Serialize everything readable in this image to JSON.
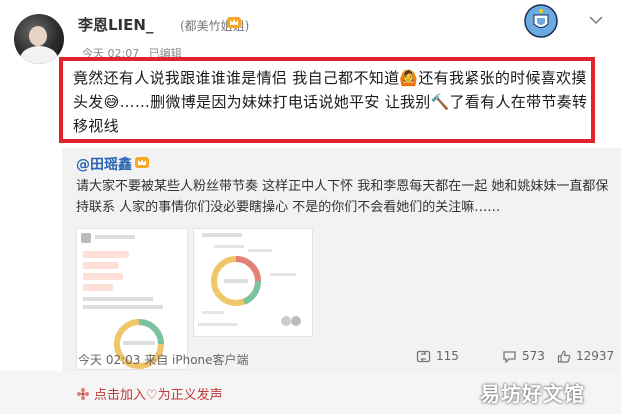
{
  "post": {
    "username": "李恩LIEN_",
    "remark": "(都美竹姐姐)",
    "time": "今天 02:07",
    "edited": "已编辑",
    "text": "竟然还有人说我跟谁谁谁是情侣 我自己都不知道🙆还有我紧张的时候喜欢摸头发😅……删微博是因为妹妹打电话说她平安 让我别🔨了看有人在带节奏转移视线",
    "highlight_color": "#e5212b"
  },
  "repost": {
    "username": "@田瑶鑫",
    "text": "请大家不要被某些人粉丝带节奏 这样正中人下怀 我和李恩每天都在一起 她和姚妹妹一直都保持联系 人家的事情你们没必要瞎操心 不是的你们不会看她们的关注嘛……",
    "time": "今天 02:03 来自 iPhone客户端",
    "repost_count": "115",
    "comment_count": "573",
    "like_count": "12937"
  },
  "icons": {
    "vip": "crown-badge-icon",
    "club": "manchester-city-badge-icon",
    "chevron": "chevron-down-icon",
    "repost": "repost-icon",
    "comment": "comment-icon",
    "like": "like-icon",
    "support": "love-support-icon"
  },
  "bottom": {
    "support_text": "点击加入♡为正义发声",
    "watermark": "易坊好文馆"
  }
}
